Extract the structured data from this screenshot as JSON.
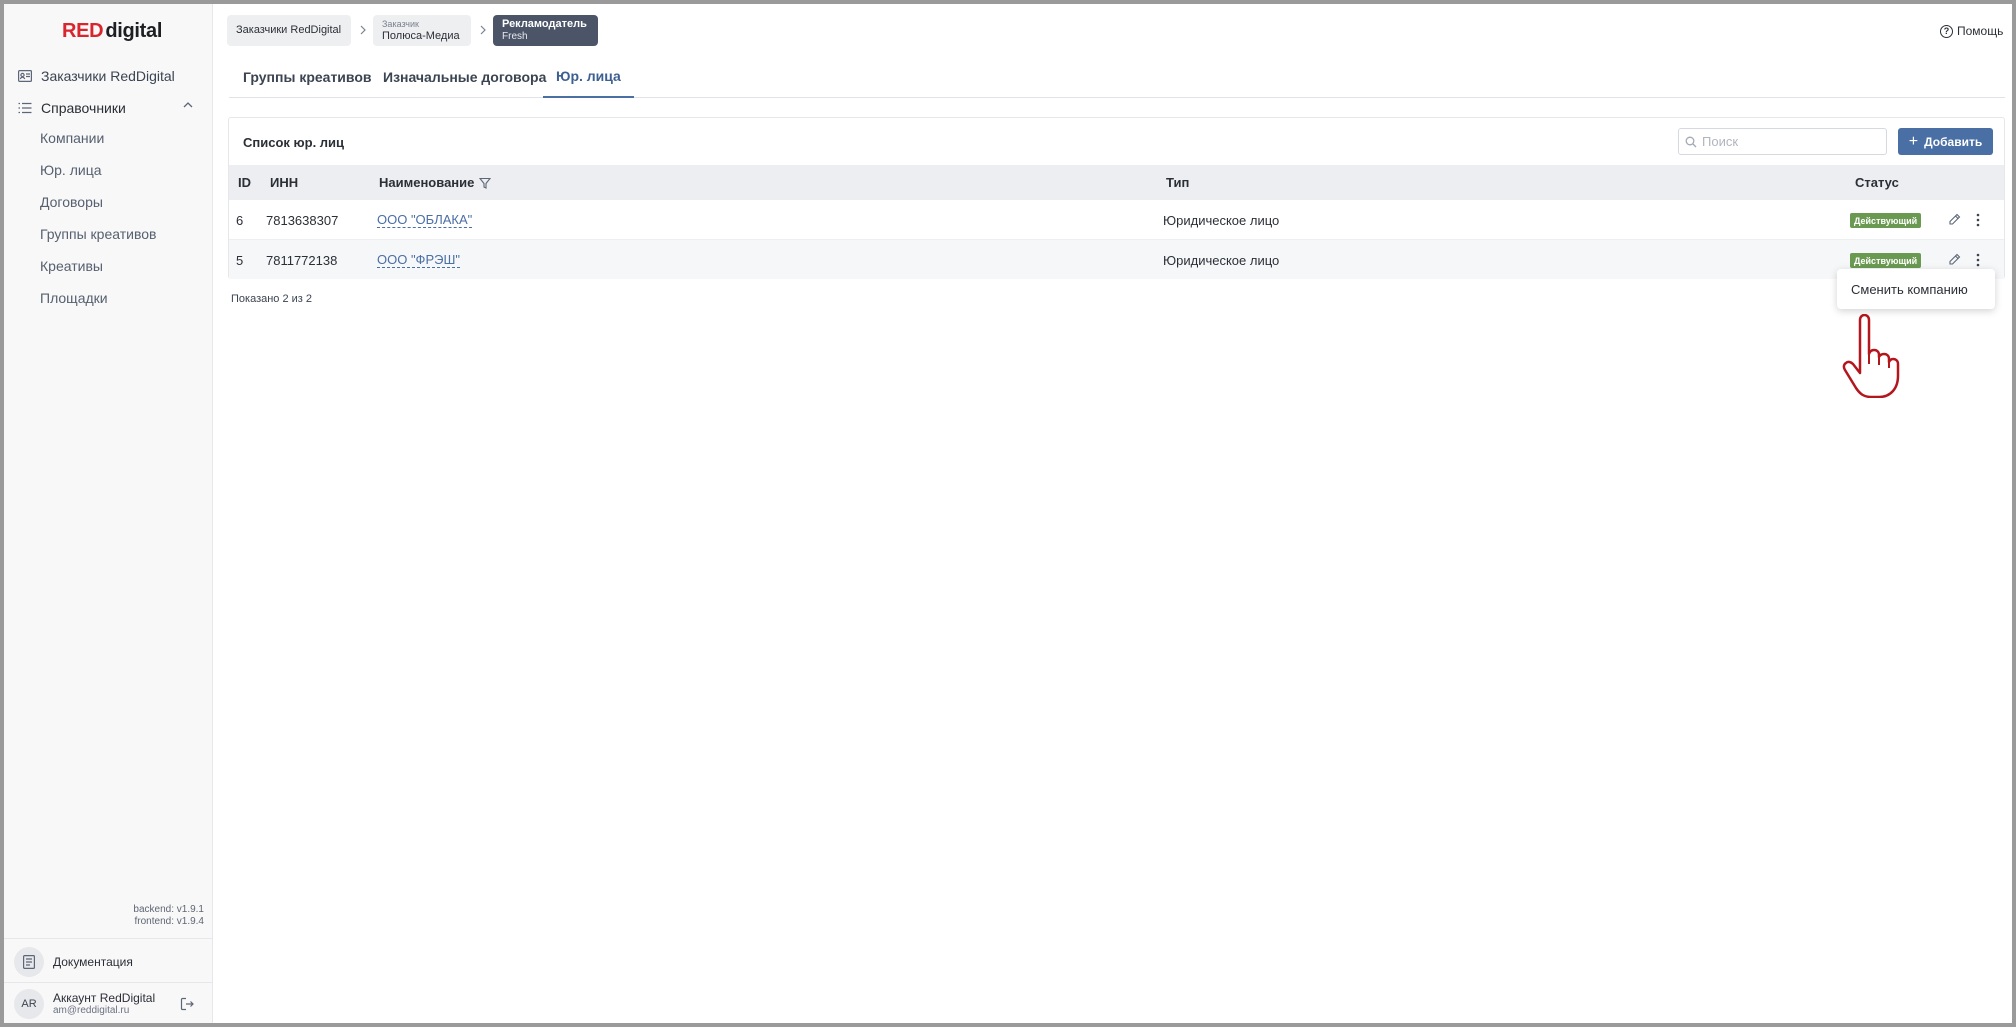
{
  "brand": {
    "logo_red": "RED",
    "logo_rest": "digital"
  },
  "sidebar": {
    "clients_label": "Заказчики RedDigital",
    "dictionaries_label": "Справочники",
    "sub_items": [
      "Компании",
      "Юр. лица",
      "Договоры",
      "Группы креативов",
      "Креативы",
      "Площадки"
    ],
    "backend_version": "backend: v1.9.1",
    "frontend_version": "frontend: v1.9.4",
    "docs_label": "Документация",
    "account_initials": "AR",
    "account_name": "Аккаунт RedDigital",
    "account_email": "am@reddigital.ru"
  },
  "breadcrumbs": {
    "first": "Заказчики RedDigital",
    "second_small": "Заказчик",
    "second": "Полюса-Медиа",
    "third": "Рекламодатель",
    "third_small": "Fresh"
  },
  "help_label": "Помощь",
  "tabs": [
    "Группы креативов",
    "Изначальные договора",
    "Юр. лица"
  ],
  "active_tab": "Юр. лица",
  "list": {
    "title": "Список юр. лиц",
    "search_placeholder": "Поиск",
    "add_label": "Добавить",
    "columns": {
      "id": "ID",
      "inn": "ИНН",
      "name": "Наименование",
      "type": "Тип",
      "status": "Статус"
    },
    "rows": [
      {
        "id": "6",
        "inn": "7813638307",
        "name": "ООО \"ОБЛАКА\"",
        "type": "Юридическое лицо",
        "status": "Действующий"
      },
      {
        "id": "5",
        "inn": "7811772138",
        "name": "ООО \"ФРЭШ\"",
        "type": "Юридическое лицо",
        "status": "Действующий"
      }
    ],
    "shown_text": "Показано 2 из 2"
  },
  "context_menu": {
    "change_company": "Сменить компанию"
  },
  "colors": {
    "accent": "#4a6fa5",
    "status_green": "#6a9a52",
    "brand_red": "#d9262e",
    "crumb_active": "#4b5567"
  }
}
